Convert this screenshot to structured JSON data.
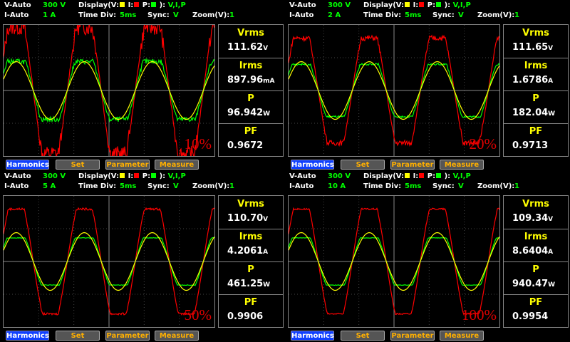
{
  "colors": {
    "voltage": "#ffff00",
    "current": "#ff0000",
    "power": "#00ff00",
    "accent": "#00ff00",
    "harmonics_bg": "#1040ff"
  },
  "display_label": "Display(",
  "v_label": "V:",
  "i_label": "I:",
  "p_label": "P:",
  "display_close": "):",
  "display_channels": "V,I,P",
  "time_div_label": "Time  Div:",
  "sync_label": "Sync:",
  "zoom_label": "Zoom(V):",
  "buttons": {
    "harmonics": "Harmonics",
    "set": "Set",
    "parameter": "Parameter",
    "measure": "Measure"
  },
  "measure_labels": {
    "vrms": "Vrms",
    "irms": "Irms",
    "p": "P",
    "pf": "PF"
  },
  "panels": [
    {
      "v_mode": "V-Auto",
      "v_range": "300  V",
      "i_mode": "I-Auto",
      "i_range": "1  A",
      "time_div": "5ms",
      "sync": "V",
      "zoom": "1",
      "vrms": "111.62",
      "vrms_unit": "V",
      "irms": "897.96",
      "irms_unit": "mA",
      "p": "96.942",
      "p_unit": "W",
      "pf": "0.9672",
      "percent": "10%",
      "wave": {
        "v_amp": 0.22,
        "i_amp": 0.48,
        "p_amp": 0.22,
        "noise": 0.12
      }
    },
    {
      "v_mode": "V-Auto",
      "v_range": "300  V",
      "i_mode": "I-Auto",
      "i_range": "2  A",
      "time_div": "5ms",
      "sync": "V",
      "zoom": "1",
      "vrms": "111.65",
      "vrms_unit": "V",
      "irms": "1.6786",
      "irms_unit": "A",
      "p": "182.04",
      "p_unit": "W",
      "pf": "0.9713",
      "percent": "20%",
      "wave": {
        "v_amp": 0.22,
        "i_amp": 0.4,
        "p_amp": 0.2,
        "noise": 0.05
      }
    },
    {
      "v_mode": "V-Auto",
      "v_range": "300  V",
      "i_mode": "I-Auto",
      "i_range": "5  A",
      "time_div": "5ms",
      "sync": "V",
      "zoom": "1",
      "vrms": "110.70",
      "vrms_unit": "V",
      "irms": "4.2061",
      "irms_unit": "A",
      "p": "461.25",
      "p_unit": "W",
      "pf": "0.9906",
      "percent": "50%",
      "wave": {
        "v_amp": 0.22,
        "i_amp": 0.4,
        "p_amp": 0.18,
        "noise": 0.02
      }
    },
    {
      "v_mode": "V-Auto",
      "v_range": "300  V",
      "i_mode": "I-Auto",
      "i_range": "10  A",
      "time_div": "5ms",
      "sync": "V",
      "zoom": "1",
      "vrms": "109.34",
      "vrms_unit": "V",
      "irms": "8.6404",
      "irms_unit": "A",
      "p": "940.47",
      "p_unit": "W",
      "pf": "0.9954",
      "percent": "100%",
      "wave": {
        "v_amp": 0.22,
        "i_amp": 0.4,
        "p_amp": 0.18,
        "noise": 0.015
      }
    }
  ]
}
